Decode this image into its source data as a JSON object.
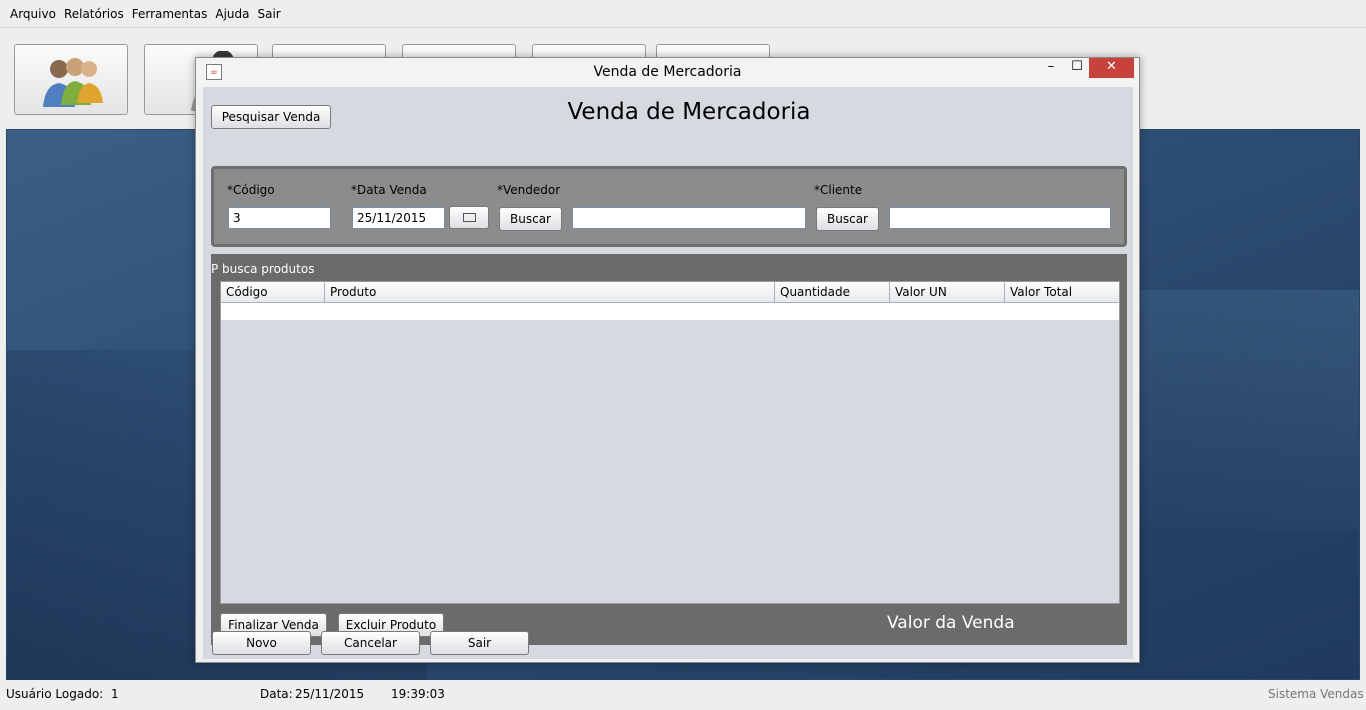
{
  "menu": [
    "Arquivo",
    "Relatórios",
    "Ferramentas",
    "Ajuda",
    "Sair"
  ],
  "toolbar_icons": [
    "users-group-icon",
    "user-icon",
    "chart-icon",
    "box-icon",
    "document-icon",
    "tools-icon"
  ],
  "dialog": {
    "title": "Venda de Mercadoria",
    "controls": {
      "minimize": "–",
      "maximize": "☐",
      "close": "✕"
    },
    "search_button": "Pesquisar Venda",
    "heading": "Venda de Mercadoria",
    "form": {
      "codigo_label": "*Código",
      "codigo_value": "3",
      "data_label": "*Data Venda",
      "data_value": "25/11/2015",
      "vendedor_label": "*Vendedor",
      "vendedor_button": "Buscar",
      "vendedor_value": "",
      "cliente_label": "*Cliente",
      "cliente_button": "Buscar",
      "cliente_value": ""
    },
    "products": {
      "panel_label": "P busca produtos",
      "columns": [
        "Código",
        "Produto",
        "Quantidade",
        "Valor UN",
        "Valor Total"
      ],
      "rows": []
    },
    "finalizar_button": "Finalizar Venda",
    "excluir_button": "Excluir Produto",
    "valor_label": "Valor da Venda",
    "novo_button": "Novo",
    "cancelar_button": "Cancelar",
    "sair_button": "Sair"
  },
  "status": {
    "user_label": "Usuário Logado:",
    "user_value": "1",
    "date_label": "Data:",
    "date_value": "25/11/2015",
    "time": "19:39:03",
    "system": "Sistema Vendas"
  }
}
